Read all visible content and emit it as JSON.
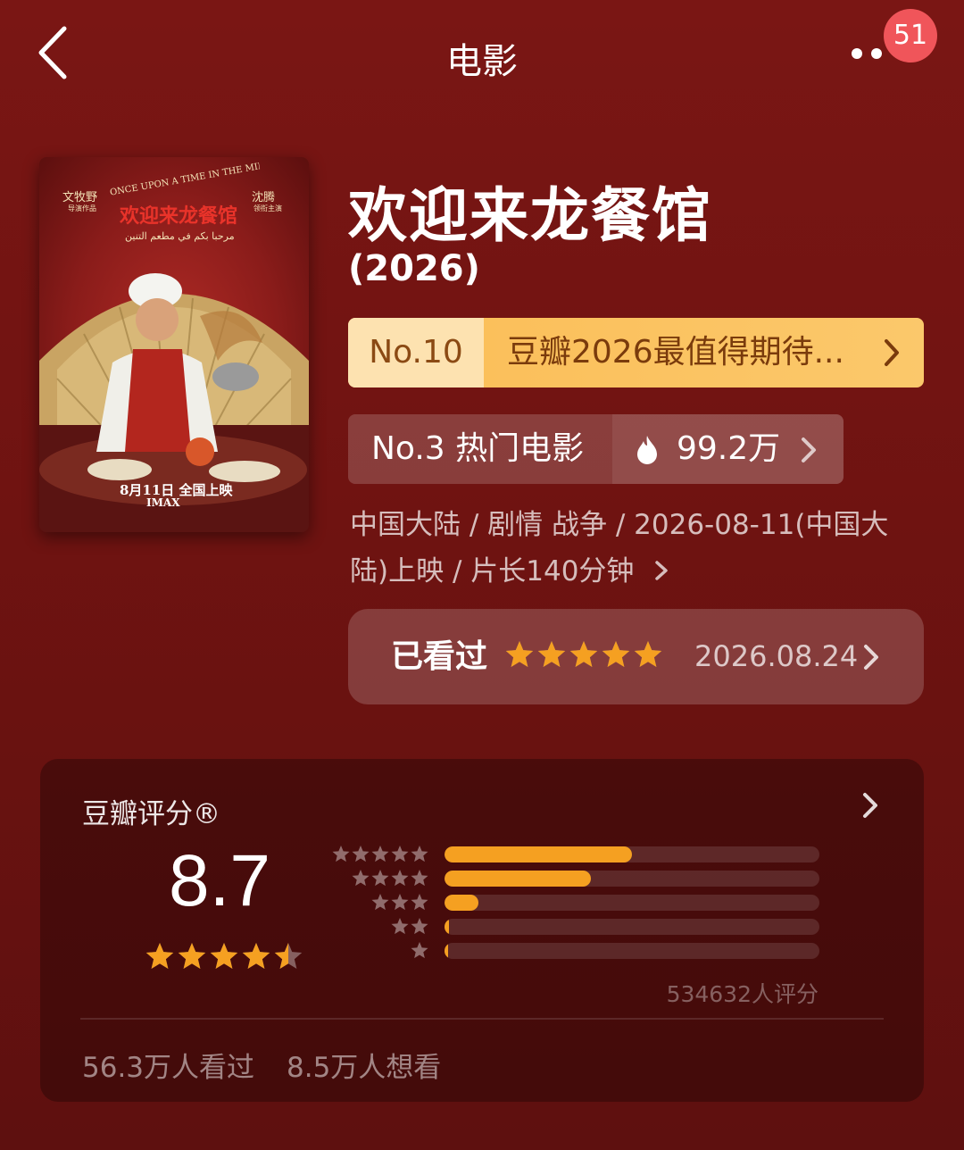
{
  "header": {
    "title": "电影",
    "notification_count": "51",
    "icons": [
      "chevron-left-icon",
      "more-icon"
    ]
  },
  "poster": {
    "director_name": "文牧野",
    "director_role": "导演作品",
    "lead_name": "沈腾",
    "lead_role": "领衔主演",
    "english_title": "ONCE UPON A TIME IN THE MIDDLE EAST",
    "chinese_title": "欢迎来龙餐馆",
    "arabic_title": "مرحبا بكم في مطعم التنين",
    "release_text": "8月11日 全国上映",
    "format": "IMAX"
  },
  "movie": {
    "title": "欢迎来龙餐馆",
    "year": "(2026)",
    "meta_line1": "中国大陆 / 剧情 战争 / 2026-08-11(中国大",
    "meta_line2": "陆)上映 / 片长140分钟"
  },
  "ranks": {
    "primary_no": "No.10",
    "primary_text": "豆瓣2026最值得期待...",
    "secondary_text": "No.3 热门电影",
    "heat_count": "99.2万"
  },
  "watched": {
    "label": "已看过",
    "stars": 5,
    "date": "2026.08.24"
  },
  "rating": {
    "title": "豆瓣评分®",
    "score": "8.7",
    "score_stars": 4.5,
    "raters": "534632人评分",
    "distribution": [
      {
        "stars": 5,
        "fraction": 0.5
      },
      {
        "stars": 4,
        "fraction": 0.39
      },
      {
        "stars": 3,
        "fraction": 0.09
      },
      {
        "stars": 2,
        "fraction": 0.012
      },
      {
        "stars": 1,
        "fraction": 0.005
      }
    ],
    "watched_count": "56.3万人看过",
    "want_count": "8.5万人想看"
  },
  "colors": {
    "background": "#6f1311",
    "accent_orange": "#f5a021",
    "rank_gold": "#fbbd56",
    "badge_red": "#f0555a"
  }
}
